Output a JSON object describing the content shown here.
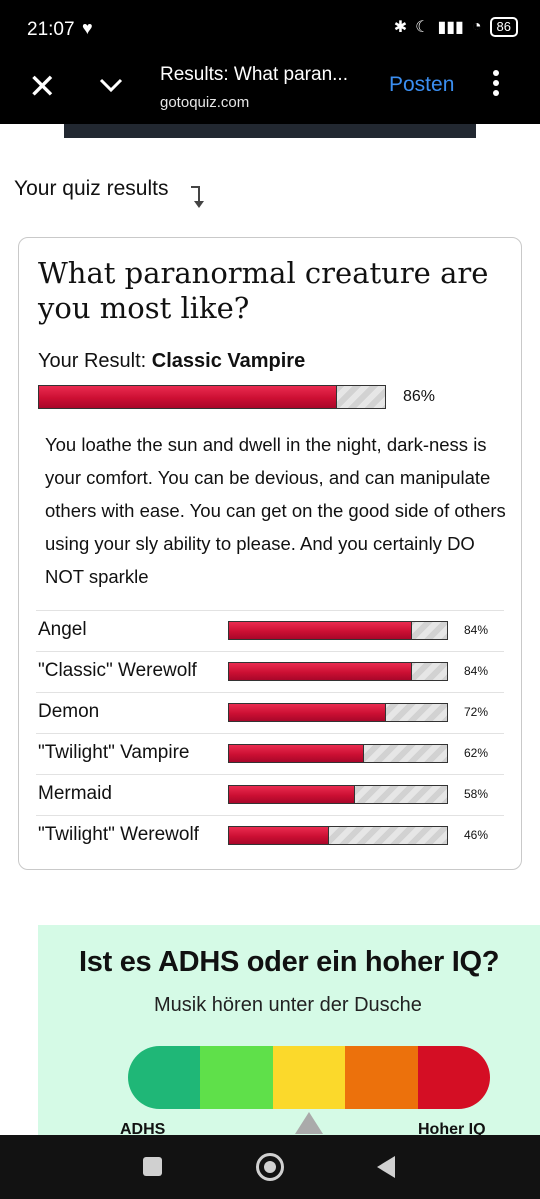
{
  "status_bar": {
    "time": "21:07",
    "battery": "86"
  },
  "toolbar": {
    "title": "Results: What paran...",
    "url": "gotoquiz.com",
    "post_label": "Posten"
  },
  "page": {
    "results_heading": "Your quiz results"
  },
  "card": {
    "title": "What paranormal creature are you most like?",
    "your_result_label": "Your Result:",
    "result_name": "Classic Vampire",
    "result_percent": 86,
    "result_percent_label": "86%",
    "description": "You loathe the sun and dwell in the night, dark-ness is your comfort. You can be devious, and can manipulate others with ease. You can get on the good side of others using your sly ability to please. And you certainly DO NOT sparkle",
    "other_results": [
      {
        "label": "Angel",
        "percent": 84,
        "percent_label": "84%"
      },
      {
        "label": "\"Classic\" Werewolf",
        "percent": 84,
        "percent_label": "84%"
      },
      {
        "label": "Demon",
        "percent": 72,
        "percent_label": "72%"
      },
      {
        "label": "\"Twilight\" Vampire",
        "percent": 62,
        "percent_label": "62%"
      },
      {
        "label": "Mermaid",
        "percent": 58,
        "percent_label": "58%"
      },
      {
        "label": "\"Twilight\" Werewolf",
        "percent": 46,
        "percent_label": "46%"
      }
    ]
  },
  "ad": {
    "title": "Ist es ADHS oder ein hoher IQ?",
    "subtitle": "Musik hören unter der Dusche",
    "left_label": "ADHS",
    "right_label": "Hoher IQ",
    "gauge_colors": [
      "#1fb777",
      "#5fe04a",
      "#fbd92b",
      "#ec710c",
      "#d40e24"
    ]
  },
  "colors": {
    "accent_link": "#3b8ef0",
    "bar_fill": "#d4163a"
  }
}
